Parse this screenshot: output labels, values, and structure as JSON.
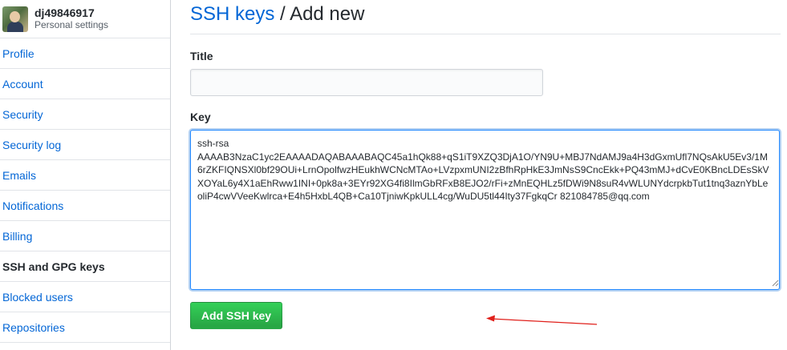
{
  "sidebar": {
    "username": "dj49846917",
    "subtitle": "Personal settings",
    "items": [
      {
        "label": "Profile"
      },
      {
        "label": "Account"
      },
      {
        "label": "Security"
      },
      {
        "label": "Security log"
      },
      {
        "label": "Emails"
      },
      {
        "label": "Notifications"
      },
      {
        "label": "Billing"
      },
      {
        "label": "SSH and GPG keys",
        "selected": true
      },
      {
        "label": "Blocked users"
      },
      {
        "label": "Repositories"
      }
    ]
  },
  "header": {
    "breadcrumb_link": "SSH keys",
    "separator": " / ",
    "current": "Add new"
  },
  "form": {
    "title_label": "Title",
    "title_value": "",
    "key_label": "Key",
    "key_value": "ssh-rsa\nAAAAB3NzaC1yc2EAAAADAQABAAABAQC45a1hQk88+qS1iT9XZQ3DjA1O/YN9U+MBJ7NdAMJ9a4H3dGxmUfl7NQsAkU5Ev3/1M6rZKFIQNSXl0bf29OUi+LrnOpolfwzHEukhWCNcMTAo+LVzpxmUNI2zBfhRpHkE3JmNsS9CncEkk+PQ43mMJ+dCvE0KBncLDEsSkVXOYaL6y4X1aEhRww1INI+0pk8a+3EYr92XG4fi8IlmGbRFxB8EJO2/rFi+zMnEQHLz5fDWi9N8suR4vWLUNYdcrpkbTut1tnq3aznYbLeoliP4cwVVeeKwlrca+E4h5HxbL4QB+Ca10TjniwKpkULL4cg/WuDU5tl44Ity37FgkqCr 821084785@qq.com\n",
    "submit_label": "Add SSH key"
  },
  "colors": {
    "link": "#0366d6",
    "button_green": "#28a745",
    "focus_border": "#2188ff",
    "annotation_arrow": "#e0201b"
  }
}
